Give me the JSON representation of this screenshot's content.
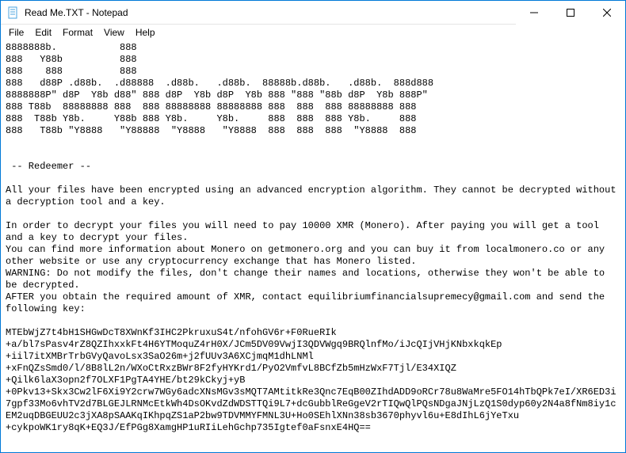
{
  "window": {
    "title": "Read Me.TXT - Notepad"
  },
  "menu": {
    "file": "File",
    "edit": "Edit",
    "format": "Format",
    "view": "View",
    "help": "Help"
  },
  "body_text": "8888888b.           888\n888   Y88b          888\n888    888          888\n888   d88P .d88b.  .d88888  .d88b.   .d88b.  88888b.d88b.   .d88b.  888d888\n8888888P\" d8P  Y8b d88\" 888 d8P  Y8b d8P  Y8b 888 \"888 \"88b d8P  Y8b 888P\"\n888 T88b  88888888 888  888 88888888 88888888 888  888  888 88888888 888\n888  T88b Y8b.     Y88b 888 Y8b.     Y8b.     888  888  888 Y8b.     888\n888   T88b \"Y8888   \"Y88888  \"Y8888   \"Y8888  888  888  888  \"Y8888  888\n\n\n -- Redeemer --\n\nAll your files have been encrypted using an advanced encryption algorithm. They cannot be decrypted without a decryption tool and a key.\n\nIn order to decrypt your files you will need to pay 10000 XMR (Monero). After paying you will get a tool and a key to decrypt your files.\nYou can find more information about Monero on getmonero.org and you can buy it from localmonero.co or any other website or use any cryptocurrency exchange that has Monero listed.\nWARNING: Do not modify the files, don't change their names and locations, otherwise they won't be able to be decrypted.\nAFTER you obtain the required amount of XMR, contact equilibriumfinancialsupremecy@gmail.com and send the following key:\n\nMTEbWjZ7t4bH1SHGwDcT8XWnKf3IHC2PkruxuS4t/nfohGV6r+F0RueRIk\n+a/bl7sPasv4rZ8QZIhxxkFt4H6YTMoquZ4rH0X/JCm5DV09VwjI3QDVWgq9BRQlnfMo/iJcQIjVHjKNbxkqkEp\n+iil7itXMBrTrbGVyQavoLsx3SaO26m+j2fUUv3A6XCjmqM1dhLNMl\n+xFnQZsSmd0/l/8B8lL2n/WXoCtRxzBWr8F2fyHYKrd1/PyO2VmfvL8BCfZb5mHzWxF7Tjl/E34XIQZ\n+Qilk6laX3opn2f7OLXF1PgTA4YHE/bt29kCkyj+yB\n+0Pkv13+Skx3Cw2lF6Xi9Y2crw7WGy6adcXNsMGv3sMQT7AMtitkRe3Qnc7EqB00ZIhdADD9oRCr78u8WaMre5FO14hTbQPk7eI/XR6ED3i7gpf33Mo6vhTV2d7BLGEJLRNMcEtkWh4DsOKvdZdWDSTTQi9L7+dcGubblReGgeV2rTIQwQlPQsNDgaJNjLzQ1S0dyp60y2N4a8fNm8iy1cEM2uqDBGEUU2c3jXA8pSAAKqIKhpqZS1aP2bw9TDVMMYFMNL3U+Ho0SEhlXNn38sb3670phyvl6u+E8dIhL6jYeTxu\n+cykpoWK1ry8qK+EQ3J/EfPGg8XamgHP1uRIiLehGchp735Igtef0aFsnxE4HQ=="
}
